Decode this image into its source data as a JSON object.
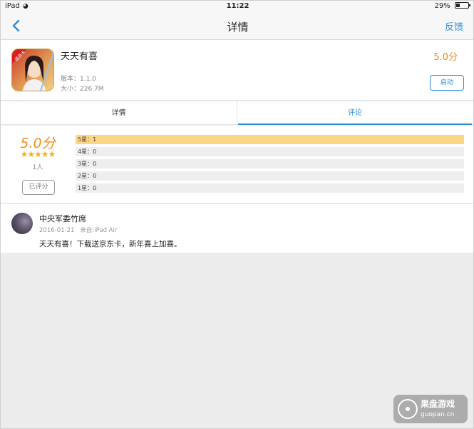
{
  "status_bar": {
    "device": "iPad",
    "time": "11:22",
    "battery": "29%",
    "battery_level": 0.29
  },
  "nav": {
    "title": "详情",
    "feedback": "反馈"
  },
  "app": {
    "name": "天天有喜",
    "version": "版本：1.1.0",
    "size": "大小：226.7M",
    "score": "5.0分",
    "launch_label": "启动",
    "icon_badge": "送京卡"
  },
  "tabs": [
    {
      "label": "详情",
      "active": false
    },
    {
      "label": "评论",
      "active": true
    }
  ],
  "rating": {
    "score": "5.0分",
    "stars": "★★★★★",
    "count": "1人",
    "rated_label": "已评分",
    "bars": [
      {
        "label": "5星：1",
        "fraction": 1.0
      },
      {
        "label": "4星：0",
        "fraction": 0
      },
      {
        "label": "3星：0",
        "fraction": 0
      },
      {
        "label": "2星：0",
        "fraction": 0
      },
      {
        "label": "1星：0",
        "fraction": 0
      }
    ]
  },
  "comment": {
    "user": "中央军委竹席",
    "date": "2016-01-21",
    "source": "来自:iPad Air",
    "text": "天天有喜！下载送京东卡，新年喜上加喜。"
  },
  "watermark": {
    "brand": "果盘游戏",
    "domain": "guopan.cn"
  },
  "colors": {
    "accent": "#2e8ddb",
    "score": "#f08c1c",
    "star": "#f2b01e",
    "bar_fill": "#fcd683"
  }
}
